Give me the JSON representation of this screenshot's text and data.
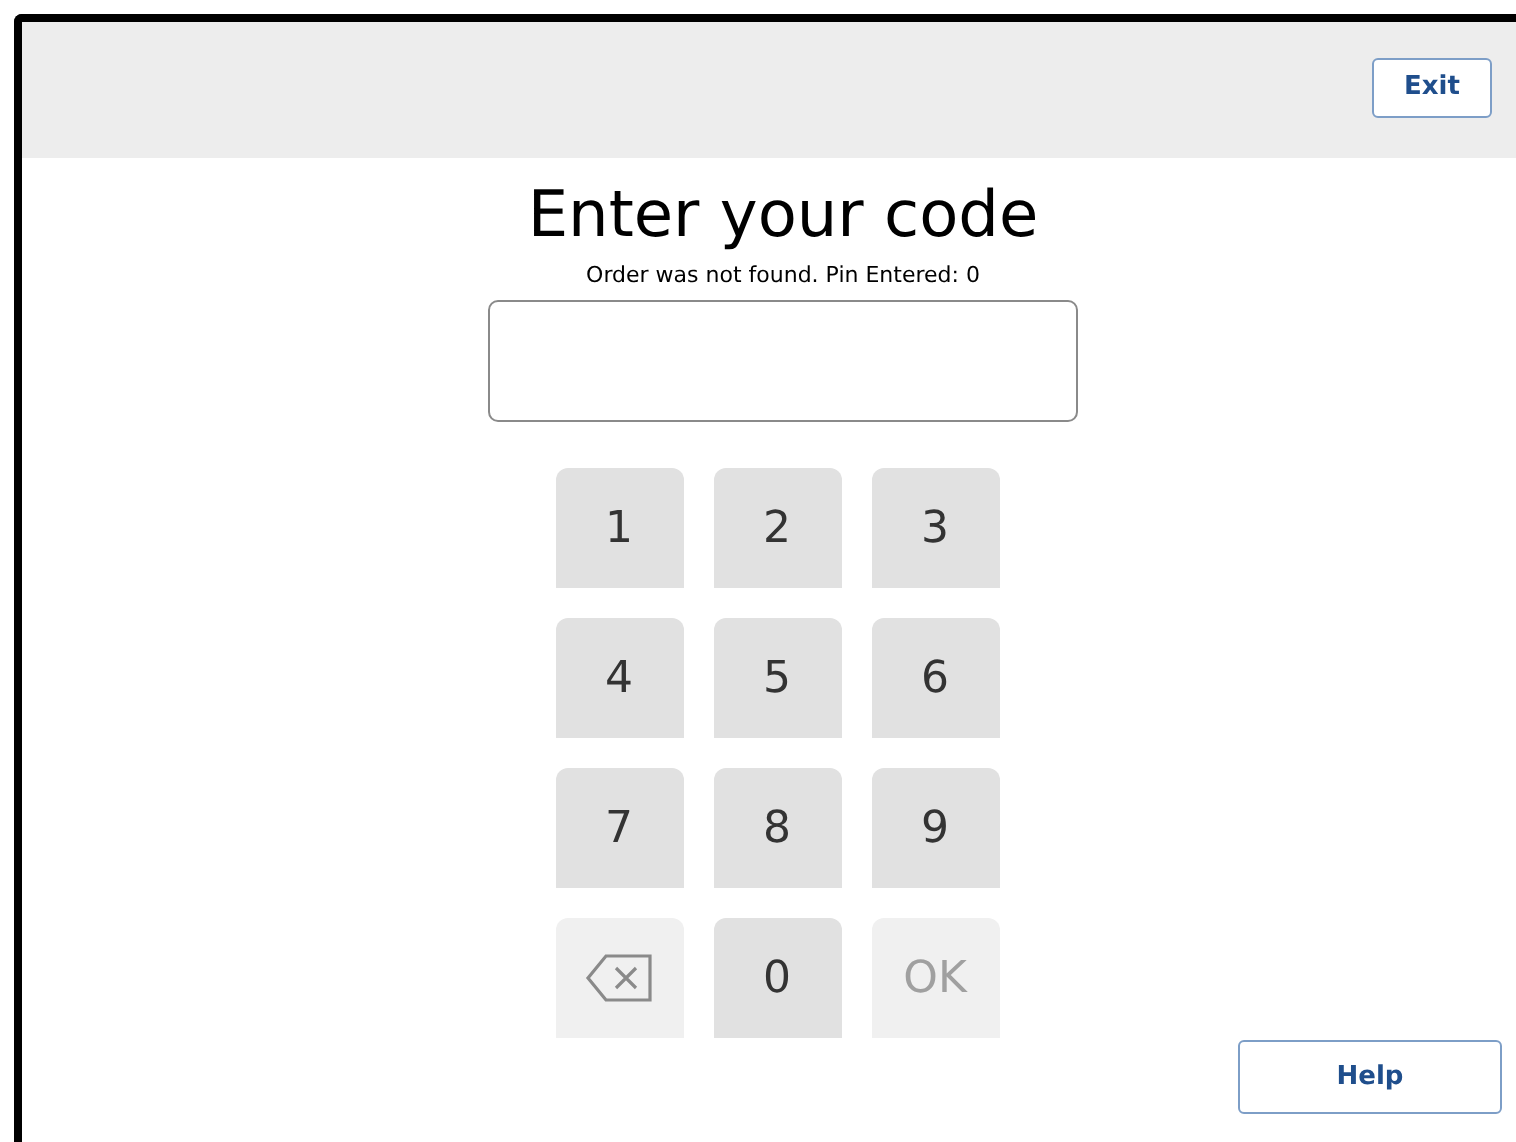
{
  "header": {
    "exit_button": "Exit"
  },
  "title": "Enter your code",
  "message": "Order was not found. Pin Entered: 0",
  "keypad": [
    {
      "kind": "digit",
      "label": "1",
      "disabled": false
    },
    {
      "kind": "digit",
      "label": "2",
      "disabled": false
    },
    {
      "kind": "digit",
      "label": "3",
      "disabled": false
    },
    {
      "kind": "digit",
      "label": "4",
      "disabled": false
    },
    {
      "kind": "digit",
      "label": "5",
      "disabled": false
    },
    {
      "kind": "digit",
      "label": "6",
      "disabled": false
    },
    {
      "kind": "digit",
      "label": "7",
      "disabled": false
    },
    {
      "kind": "digit",
      "label": "8",
      "disabled": false
    },
    {
      "kind": "digit",
      "label": "9",
      "disabled": false
    },
    {
      "kind": "backspace",
      "disabled": true
    },
    {
      "kind": "digit",
      "label": "0",
      "disabled": false
    },
    {
      "kind": "digit",
      "label": "OK",
      "disabled": true
    }
  ],
  "help_button": "Help"
}
